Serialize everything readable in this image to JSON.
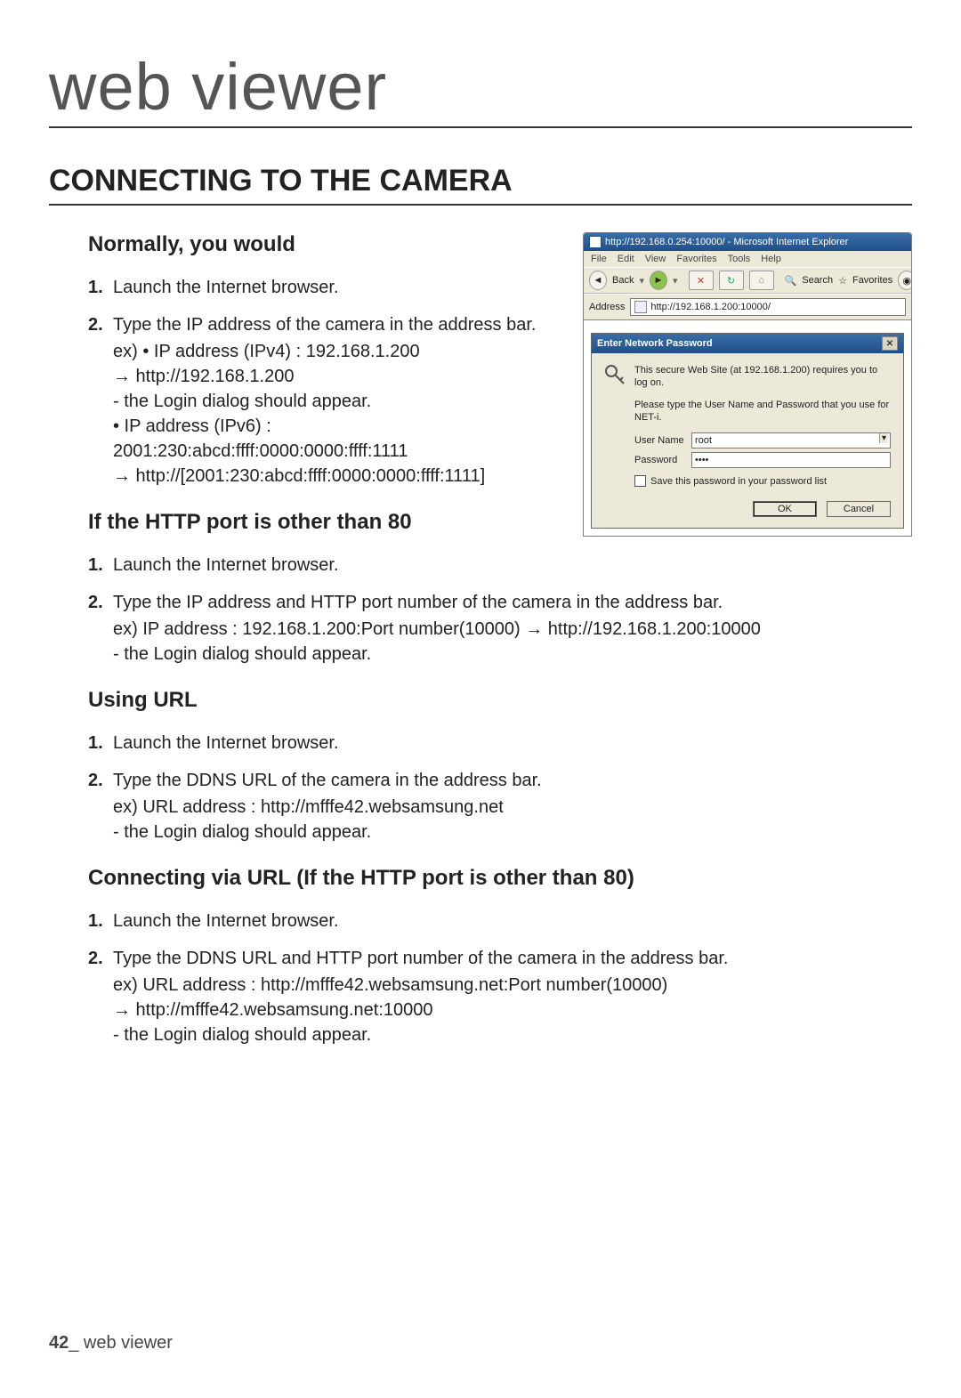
{
  "page": {
    "top_header": "web viewer",
    "chapter_title": "CONNECTING TO THE CAMERA",
    "footer_page": "42",
    "footer_label": "_ web viewer"
  },
  "sections": {
    "normally": {
      "title": "Normally, you would",
      "steps": [
        {
          "num": "1.",
          "text": "Launch the Internet browser."
        },
        {
          "num": "2.",
          "text": "Type the IP address of the camera in the address bar.",
          "sub": [
            "ex) • IP address (IPv4) : 192.168.1.200",
            "→ http://192.168.1.200",
            "- the Login dialog should appear.",
            "• IP address (IPv6) : 2001:230:abcd:ffff:0000:0000:ffff:1111",
            "→ http://[2001:230:abcd:ffff:0000:0000:ffff:1111]"
          ]
        }
      ]
    },
    "http_port": {
      "title": "If the HTTP port is other than 80",
      "steps": [
        {
          "num": "1.",
          "text": "Launch the Internet browser."
        },
        {
          "num": "2.",
          "text": "Type the IP address and HTTP port number of the camera in the address bar.",
          "sub": [
            "ex) IP address : 192.168.1.200:Port number(10000) → http://192.168.1.200:10000",
            "- the Login dialog should appear."
          ]
        }
      ]
    },
    "using_url": {
      "title": "Using URL",
      "steps": [
        {
          "num": "1.",
          "text": "Launch the Internet browser."
        },
        {
          "num": "2.",
          "text": "Type the DDNS URL of the camera in the address bar.",
          "sub": [
            "ex) URL address : http://mfffe42.websamsung.net",
            "- the Login dialog should appear."
          ]
        }
      ]
    },
    "connect_url": {
      "title": "Connecting via URL (If the HTTP port is other than 80)",
      "steps": [
        {
          "num": "1.",
          "text": "Launch the Internet browser."
        },
        {
          "num": "2.",
          "text": "Type the DDNS URL and HTTP port number of the camera in the address bar.",
          "sub": [
            "ex) URL address : http://mfffe42.websamsung.net:Port number(10000)",
            "→ http://mfffe42.websamsung.net:10000",
            "- the Login dialog should appear."
          ]
        }
      ]
    }
  },
  "ie": {
    "title": "http://192.168.0.254:10000/ - Microsoft Internet Explorer",
    "menu": [
      "File",
      "Edit",
      "View",
      "Favorites",
      "Tools",
      "Help"
    ],
    "toolbar": {
      "back": "Back",
      "search": "Search",
      "favorites": "Favorites"
    },
    "address_label": "Address",
    "address_value": "http://192.168.1.200:10000/",
    "dialog": {
      "title": "Enter Network Password",
      "line1": "This secure Web Site (at 192.168.1.200) requires you to log on.",
      "line2": "Please type the User Name and Password that you use for NET-i.",
      "user_label": "User Name",
      "user_value": "root",
      "pass_label": "Password",
      "pass_value": "••••",
      "save_label": "Save this password in your password list",
      "ok": "OK",
      "cancel": "Cancel"
    }
  }
}
